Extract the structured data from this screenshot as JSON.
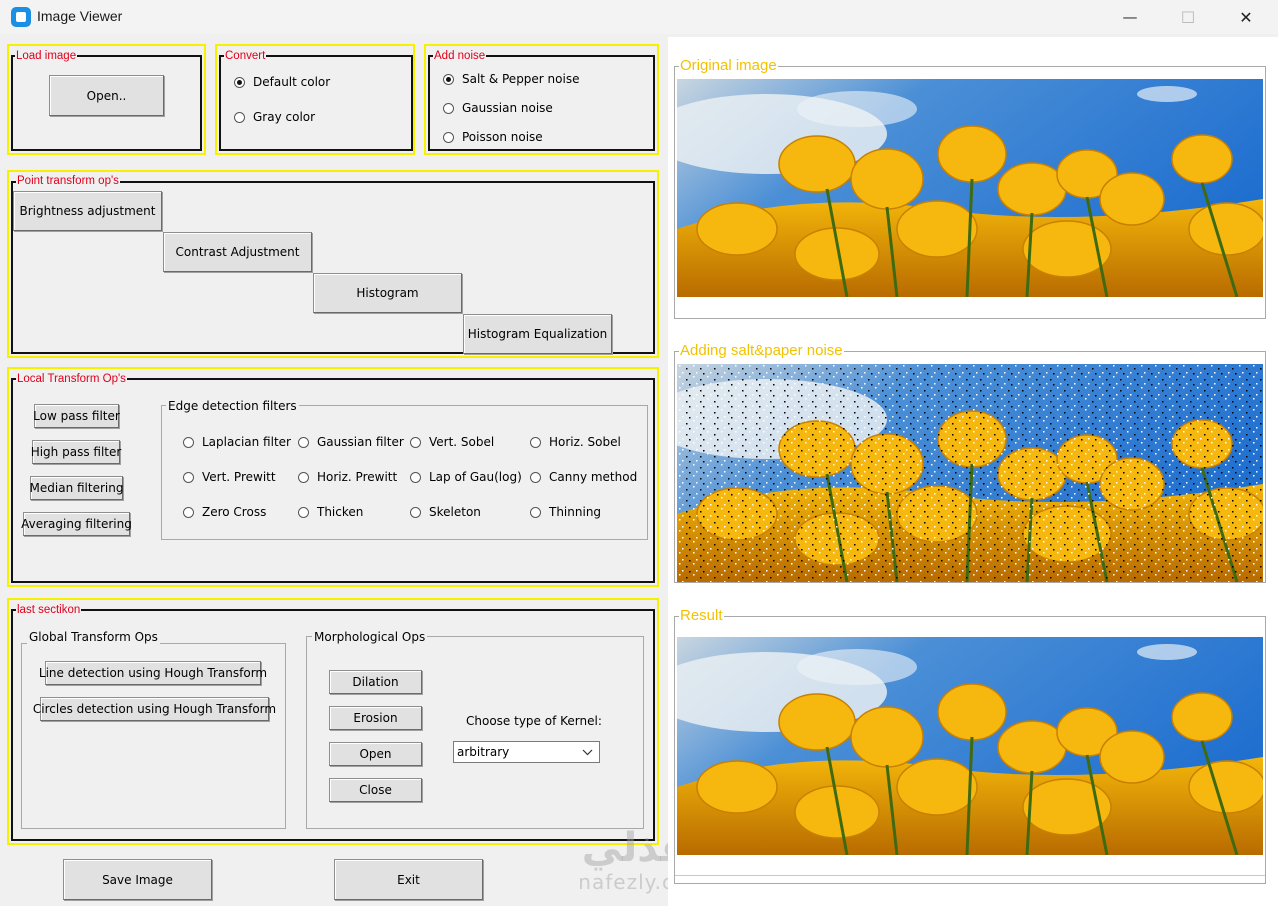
{
  "window": {
    "title": "Image Viewer",
    "minimize_glyph": "—",
    "maximize_glyph": "☐",
    "close_glyph": "✕"
  },
  "load_image": {
    "label": "Load image",
    "open_button": "Open.."
  },
  "convert": {
    "label": "Convert",
    "options": [
      "Default color",
      "Gray color"
    ],
    "selected": "Default color"
  },
  "add_noise": {
    "label": "Add noise",
    "options": [
      "Salt & Pepper noise",
      "Gaussian noise",
      "Poisson noise"
    ],
    "selected": "Salt & Pepper noise"
  },
  "point_transform": {
    "label": "Point transform op's",
    "buttons": [
      "Brightness adjustment",
      "Contrast Adjustment",
      "Histogram",
      "Histogram Equalization"
    ]
  },
  "local_transform": {
    "label": "Local Transform Op's",
    "buttons": [
      "Low pass filter",
      "High pass filter",
      "Median filtering",
      "Averaging filtering"
    ],
    "edge_group_label": "Edge detection filters",
    "edge_filters": [
      "Laplacian filter",
      "Gaussian filter",
      "Vert. Sobel",
      "Horiz. Sobel",
      "Vert. Prewitt",
      "Horiz. Prewitt",
      "Lap of Gau(log)",
      "Canny method",
      "Zero Cross",
      "Thicken",
      "Skeleton",
      "Thinning"
    ]
  },
  "last_section": {
    "label": "last sectikon",
    "global_group_label": "Global Transform Ops",
    "global_buttons": [
      "Line detection using Hough Transform",
      "Circles detection using Hough Transform"
    ],
    "morph_group_label": "Morphological Ops",
    "morph_buttons": [
      "Dilation",
      "Erosion",
      "Open",
      "Close"
    ],
    "kernel_label": "Choose type of Kernel:",
    "kernel_value": "arbitrary"
  },
  "footer": {
    "save_button": "Save Image",
    "exit_button": "Exit"
  },
  "images": {
    "original_label": "Original image",
    "noisy_label": "Adding salt&paper noise",
    "result_label": "Result"
  },
  "watermark": {
    "arabic": "نفذلي",
    "latin": "nafezly.com"
  },
  "colors": {
    "frame_yellow": "#f7f000",
    "label_red": "#e0001b",
    "image_label_yellow": "#f2c200",
    "app_icon_blue": "#1a8fe3"
  }
}
